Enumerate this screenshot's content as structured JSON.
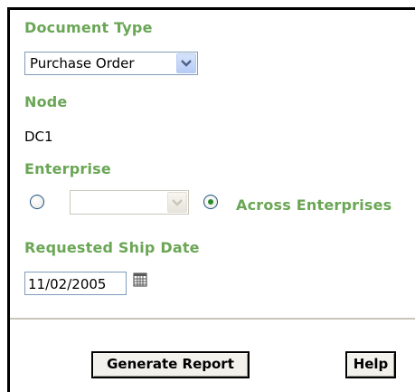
{
  "document_type": {
    "label": "Document Type",
    "selected": "Purchase Order"
  },
  "node": {
    "label": "Node",
    "value": "DC1"
  },
  "enterprise": {
    "label": "Enterprise",
    "dropdown_value": "",
    "across_label": "Across Enterprises",
    "selected_option": "across"
  },
  "requested_ship_date": {
    "label": "Requested Ship Date",
    "value": "11/02/2005"
  },
  "actions": {
    "generate_label": "Generate Report",
    "help_label": "Help"
  },
  "icons": {
    "dropdown": "chevron-down-icon",
    "calendar": "calendar-icon"
  },
  "colors": {
    "label_green": "#6aa655",
    "radio_dot": "#2a8a28",
    "dropdown_button": "#b6cbf5"
  }
}
